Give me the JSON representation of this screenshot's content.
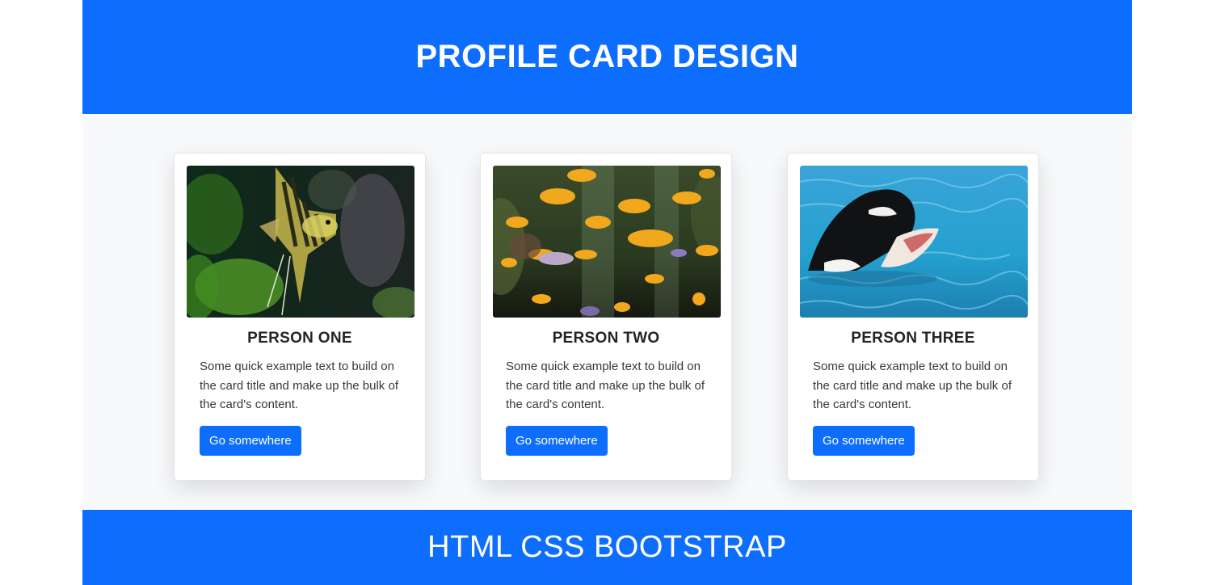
{
  "header": {
    "title": "PROFILE CARD DESIGN"
  },
  "cards": [
    {
      "title": "PERSON ONE",
      "text": "Some quick example text to build on the card title and make up the bulk of the card's content.",
      "button_label": "Go somewhere",
      "image_icon": "angelfish-photo"
    },
    {
      "title": "PERSON TWO",
      "text": "Some quick example text to build on the card title and make up the bulk of the card's content.",
      "button_label": "Go somewhere",
      "image_icon": "goldfish-aquarium-photo"
    },
    {
      "title": "PERSON THREE",
      "text": "Some quick example text to build on the card title and make up the bulk of the card's content.",
      "button_label": "Go somewhere",
      "image_icon": "orca-photo"
    }
  ],
  "footer": {
    "title": "HTML CSS BOOTSTRAP"
  },
  "colors": {
    "primary": "#0d6efd",
    "background": "#f8f9fa",
    "card": "#ffffff"
  }
}
